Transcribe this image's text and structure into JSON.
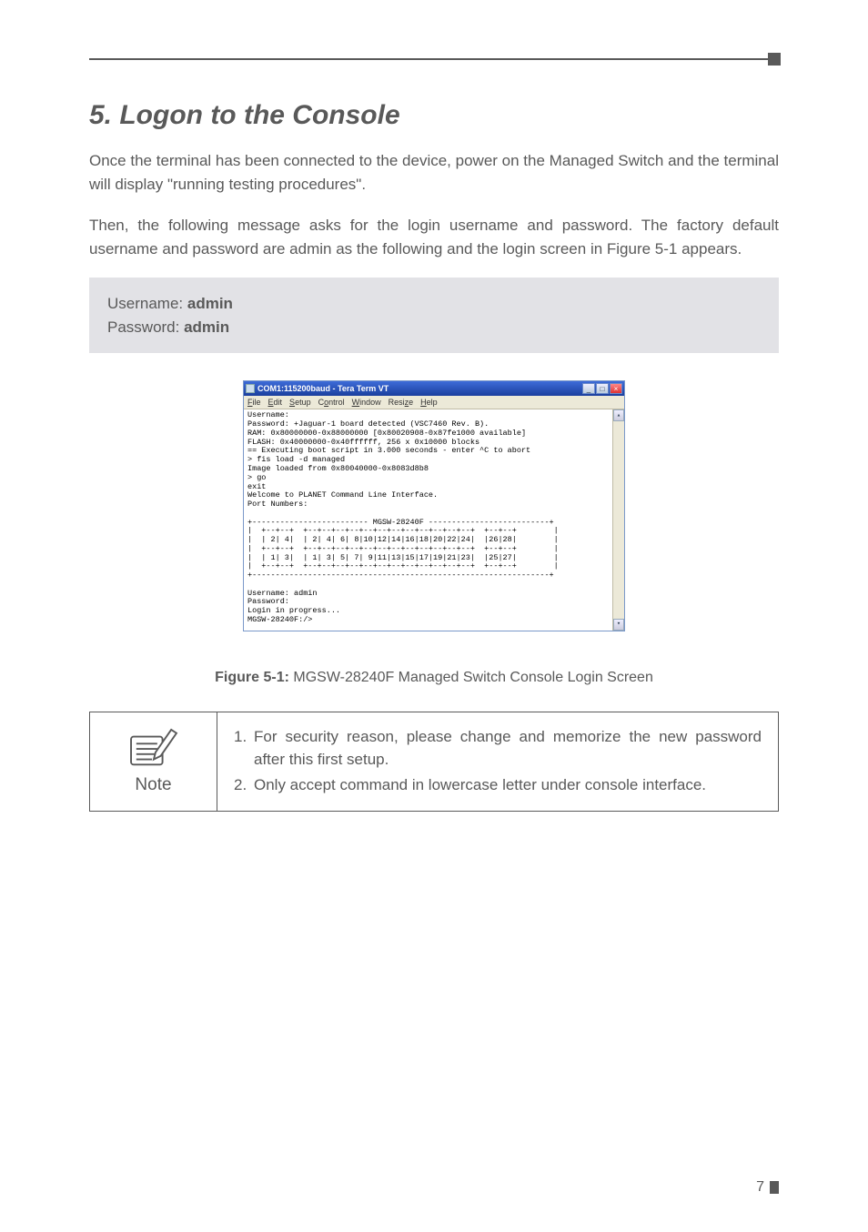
{
  "section": {
    "title": "5. Logon to the Console"
  },
  "para1": "Once the terminal has been connected to the device, power on the Managed Switch and the terminal will display \"running testing procedures\".",
  "para2": "Then, the following message asks for the login username and password. The factory default username and password are admin as the following and the login screen in Figure 5-1 appears.",
  "creds": {
    "user_label": "Username: ",
    "user_value": "admin",
    "pass_label": "Password: ",
    "pass_value": "admin"
  },
  "terminal": {
    "title": "COM1:115200baud - Tera Term VT",
    "menu": [
      "File",
      "Edit",
      "Setup",
      "Control",
      "Window",
      "Resize",
      "Help"
    ],
    "content": "Username:\nPassword: +Jaguar-1 board detected (VSC7460 Rev. B).\nRAM: 0x80000000-0x88000000 [0x80020908-0x87fe1000 available]\nFLASH: 0x40000000-0x40ffffff, 256 x 0x10000 blocks\n== Executing boot script in 3.000 seconds - enter ^C to abort\n> fis load -d managed\nImage loaded from 0x80040000-0x8083d8b8\n> go\nexit\nWelcome to PLANET Command Line Interface.\nPort Numbers:\n\n+------------------------- MGSW-28240F --------------------------+\n|  +--+--+  +--+--+--+--+--+--+--+--+--+--+--+--+  +--+--+        |\n|  | 2| 4|  | 2| 4| 6| 8|10|12|14|16|18|20|22|24|  |26|28|        |\n|  +--+--+  +--+--+--+--+--+--+--+--+--+--+--+--+  +--+--+        |\n|  | 1| 3|  | 1| 3| 5| 7| 9|11|13|15|17|19|21|23|  |25|27|        |\n|  +--+--+  +--+--+--+--+--+--+--+--+--+--+--+--+  +--+--+        |\n+----------------------------------------------------------------+\n\nUsername: admin\nPassword:\nLogin in progress...\nMGSW-28240F:/>"
  },
  "caption": {
    "label": "Figure 5-1:",
    "text": "  MGSW-28240F Managed Switch Console Login Screen"
  },
  "note": {
    "label": "Note",
    "items": [
      "For security reason, please change and memorize the new password after this first setup.",
      "Only accept command in lowercase letter under console interface."
    ]
  },
  "page_number": "7"
}
